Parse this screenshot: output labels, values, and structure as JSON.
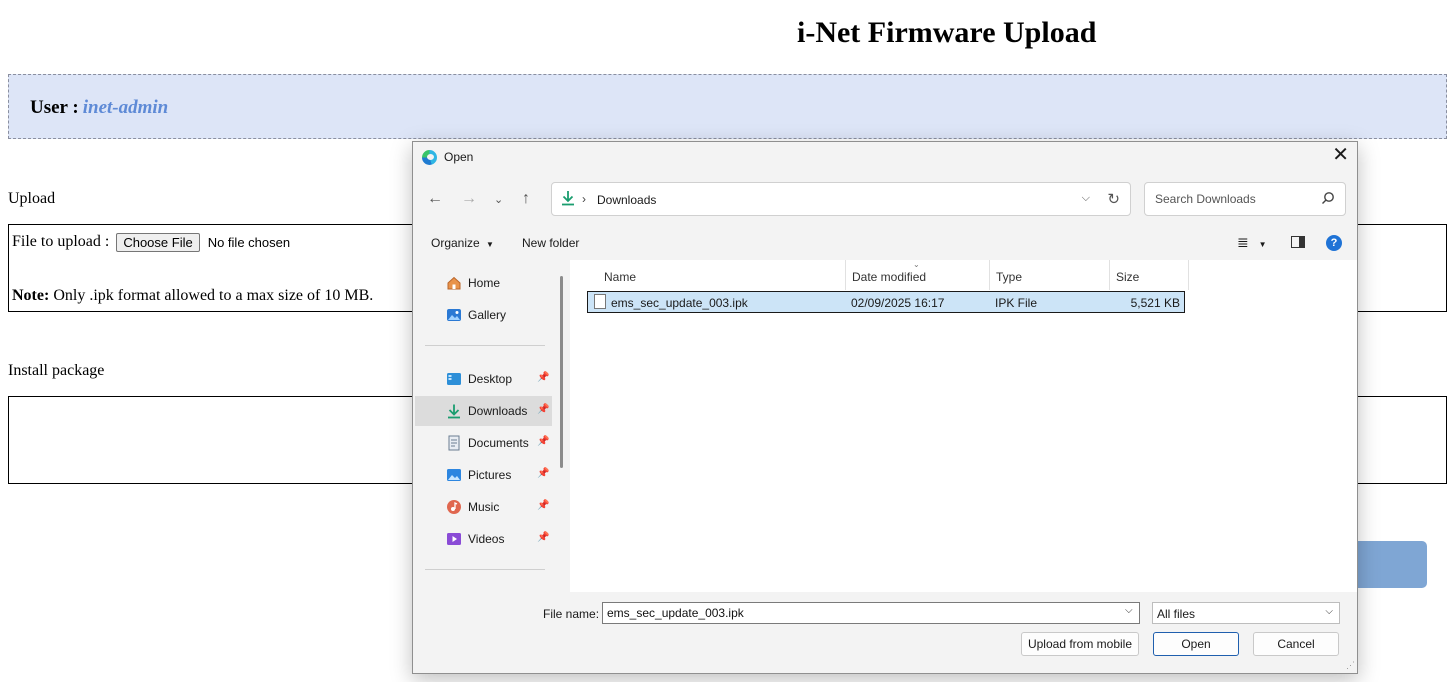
{
  "page": {
    "title": "i-Net Firmware Upload",
    "user_label": "User :",
    "user_name": "inet-admin",
    "upload_section": "Upload",
    "file_to_upload_label": "File to upload :",
    "choose_file_button": "Choose File",
    "no_file_text": "No file chosen",
    "note_label": "Note:",
    "note_text": " Only .ipk format allowed to a max size of 10 MB.",
    "install_section": "Install package"
  },
  "dialog": {
    "title": "Open",
    "address": {
      "path": "Downloads"
    },
    "search": {
      "placeholder": "Search Downloads"
    },
    "toolbar": {
      "organize": "Organize",
      "new_folder": "New folder"
    },
    "nav": [
      {
        "label": "Home",
        "icon": "home-icon",
        "pinned": false
      },
      {
        "label": "Gallery",
        "icon": "gallery-icon",
        "pinned": false
      },
      {
        "label": "Desktop",
        "icon": "desktop-icon",
        "pinned": true
      },
      {
        "label": "Downloads",
        "icon": "downloads-icon",
        "pinned": true,
        "selected": true
      },
      {
        "label": "Documents",
        "icon": "documents-icon",
        "pinned": true
      },
      {
        "label": "Pictures",
        "icon": "pictures-icon",
        "pinned": true
      },
      {
        "label": "Music",
        "icon": "music-icon",
        "pinned": true
      },
      {
        "label": "Videos",
        "icon": "videos-icon",
        "pinned": true
      }
    ],
    "columns": {
      "name": "Name",
      "date": "Date modified",
      "type": "Type",
      "size": "Size"
    },
    "files": [
      {
        "name": "ems_sec_update_003.ipk",
        "date": "02/09/2025 16:17",
        "type": "IPK File",
        "size": "5,521 KB",
        "selected": true
      }
    ],
    "file_name_label": "File name:",
    "file_name_value": "ems_sec_update_003.ipk",
    "filter": "All files",
    "buttons": {
      "upload_mobile": "Upload from mobile",
      "open": "Open",
      "cancel": "Cancel"
    }
  },
  "colors": {
    "user_bar_bg": "#dde5f7",
    "user_name": "#5e8ad6",
    "selection": "#cce4f7",
    "accent": "#1f73d6"
  }
}
